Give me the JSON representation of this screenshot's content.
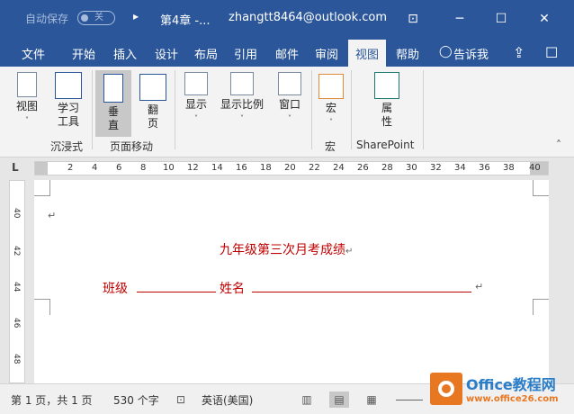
{
  "titlebar": {
    "autosave_label": "自动保存",
    "autosave_state": "关",
    "more_glyph": "▸",
    "doc_title": "第4章 -...",
    "account": "zhangtt8464@outlook.com",
    "restore_glyph": "⊡",
    "min_glyph": "─",
    "max_glyph": "☐",
    "close_glyph": "✕"
  },
  "tabs": {
    "items": [
      "文件",
      "开始",
      "插入",
      "设计",
      "布局",
      "引用",
      "邮件",
      "审阅",
      "视图",
      "帮助"
    ],
    "active": "视图",
    "tell_me": "告诉我",
    "share_glyph": "⇪",
    "comment_glyph": "☐"
  },
  "ribbon": {
    "view_btn": "视图",
    "learn_btn_line1": "学习",
    "learn_btn_line2": "工具",
    "vertical_btn_line1": "垂",
    "vertical_btn_line2": "直",
    "flip_btn_line1": "翻",
    "flip_btn_line2": "页",
    "show_btn": "显示",
    "zoom_btn": "显示比例",
    "window_btn": "窗口",
    "macro_btn": "宏",
    "props_btn_line1": "属",
    "props_btn_line2": "性",
    "group_immersive": "沉浸式",
    "group_page_move": "页面移动",
    "group_macro": "宏",
    "group_sharepoint": "SharePoint",
    "caret": "˅",
    "collapse_glyph": "˄"
  },
  "ruler": {
    "tab_glyph": "L",
    "numbers": [
      "2",
      "4",
      "6",
      "8",
      "10",
      "12",
      "14",
      "16",
      "18",
      "20",
      "22",
      "24",
      "26",
      "28",
      "30",
      "32",
      "34",
      "36",
      "38",
      "40"
    ]
  },
  "vruler": {
    "numbers": [
      "40",
      "42",
      "44",
      "46",
      "48"
    ]
  },
  "document": {
    "paragraph_mark": "↵",
    "title": "九年级第三次月考成绩",
    "class_label": "班级",
    "name_label": "姓名"
  },
  "statusbar": {
    "page_info": "第 1 页，共 1 页",
    "word_count": "530 个字",
    "language": "英语(美国)",
    "proof_glyph": "⊡",
    "read_glyph": "▥",
    "print_glyph": "▤",
    "web_glyph": "▦"
  },
  "watermark": {
    "brand": "Office教程网",
    "url": "www.office26.com"
  },
  "colors": {
    "word_blue": "#2b579a",
    "doc_red": "#c00000",
    "brand_orange": "#e87722"
  }
}
